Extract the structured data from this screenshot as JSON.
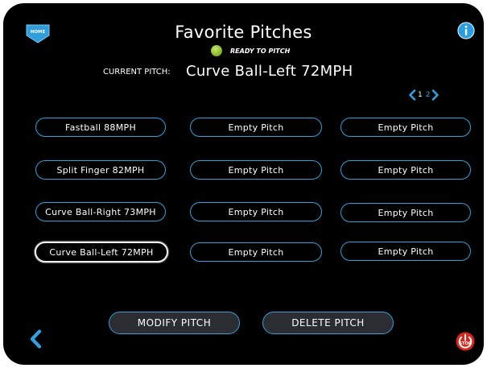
{
  "header": {
    "title": "Favorite Pitches",
    "home_label": "HOME",
    "status_text": "READY TO PITCH",
    "status_color": "#8cc43a"
  },
  "current": {
    "label": "CURRENT PITCH:",
    "value": "Curve Ball-Left 72MPH"
  },
  "pager": {
    "page1": "1",
    "page2": "2",
    "current_page": 1
  },
  "pitches": [
    [
      "Fastball 88MPH",
      "Empty Pitch",
      "Empty Pitch"
    ],
    [
      "Split Finger 82MPH",
      "Empty Pitch",
      "Empty Pitch"
    ],
    [
      "Curve Ball-Right 73MPH",
      "Empty Pitch",
      "Empty Pitch"
    ],
    [
      "Curve Ball-Left 72MPH",
      "Empty Pitch",
      "Empty Pitch"
    ]
  ],
  "selected_pitch": "Curve Ball-Left 72MPH",
  "actions": {
    "modify": "MODIFY PITCH",
    "delete": "DELETE PITCH"
  },
  "stop_label": "STOP",
  "icons": [
    "home-icon",
    "info-icon",
    "status-light-icon",
    "chevron-left-icon",
    "chevron-right-icon",
    "back-chevron-icon",
    "stop-power-icon"
  ],
  "colors": {
    "accent": "#2aa4dc",
    "background": "#000000",
    "stop": "#d8261c",
    "info": "#2a9ce0"
  }
}
